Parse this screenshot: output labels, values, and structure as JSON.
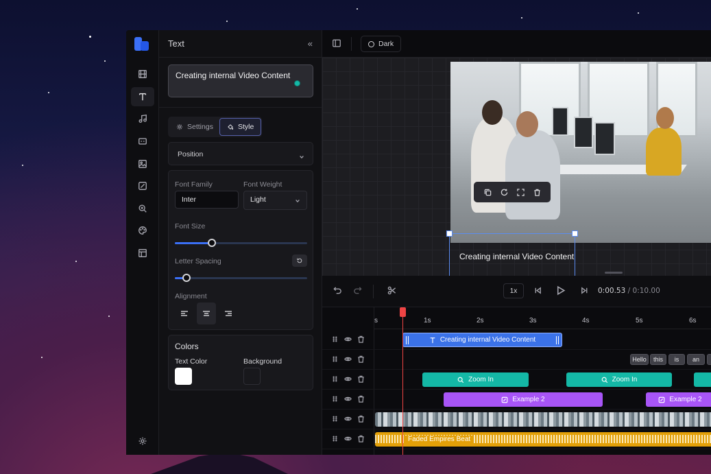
{
  "panel": {
    "title": "Text",
    "collapse_icon": "chevrons-left-icon",
    "text_preview": "Creating internal Video Content",
    "tabs": [
      {
        "label": "Settings",
        "icon": "gear-icon",
        "active": false
      },
      {
        "label": "Style",
        "icon": "paint-bucket-icon",
        "active": true
      }
    ],
    "position_label": "Position",
    "font_family_label": "Font Family",
    "font_family_value": "Inter",
    "font_weight_label": "Font Weight",
    "font_weight_value": "Light",
    "font_size_label": "Font Size",
    "font_size_level": 0.28,
    "letter_spacing_label": "Letter Spacing",
    "letter_spacing_level": 0.09,
    "alignment_label": "Alignment",
    "alignment_selected": "center",
    "colors_title": "Colors",
    "text_color_label": "Text Color",
    "text_color": "#ffffff",
    "background_label": "Background",
    "background_color": "#18181c"
  },
  "rail": {
    "items": [
      "film-icon",
      "text-icon",
      "music-icon",
      "caption-icon",
      "image-icon",
      "brush-icon",
      "zoom-icon",
      "palette-icon",
      "layout-icon"
    ],
    "active": "text-icon",
    "bottom": "gear-icon"
  },
  "topbar": {
    "theme_label": "Dark"
  },
  "canvas": {
    "selected_text": "Creating internal Video Content",
    "toolbar_icons": [
      "copy-icon",
      "refresh-icon",
      "fullscreen-icon",
      "trash-icon"
    ]
  },
  "playback": {
    "speed": "1x",
    "current_time": "0:00.53",
    "total_time": "0:10.00"
  },
  "timeline": {
    "ruler_labels": [
      "s",
      "1s",
      "2s",
      "3s",
      "4s",
      "5s",
      "6s"
    ],
    "tracks": [
      {
        "clips": [
          {
            "label": "Creating internal Video Content",
            "type": "text"
          }
        ]
      },
      {
        "clips": [
          {
            "label": "Hello"
          },
          {
            "label": "this"
          },
          {
            "label": "is"
          },
          {
            "label": "an"
          }
        ]
      },
      {
        "clips": [
          {
            "label": "Zoom In"
          },
          {
            "label": "Zoom In"
          }
        ]
      },
      {
        "clips": [
          {
            "label": "Example 2"
          },
          {
            "label": "Example 2"
          }
        ]
      },
      {
        "clips": [
          {
            "label": "",
            "type": "video"
          }
        ]
      },
      {
        "clips": [
          {
            "label": "Faded Empires Beat",
            "type": "audio"
          }
        ]
      }
    ]
  },
  "colors": {
    "accent": "#3b6ff5",
    "teal": "#14b8a6",
    "purple": "#a855f7",
    "audio": "#e3a008",
    "playhead": "#ef4444"
  }
}
